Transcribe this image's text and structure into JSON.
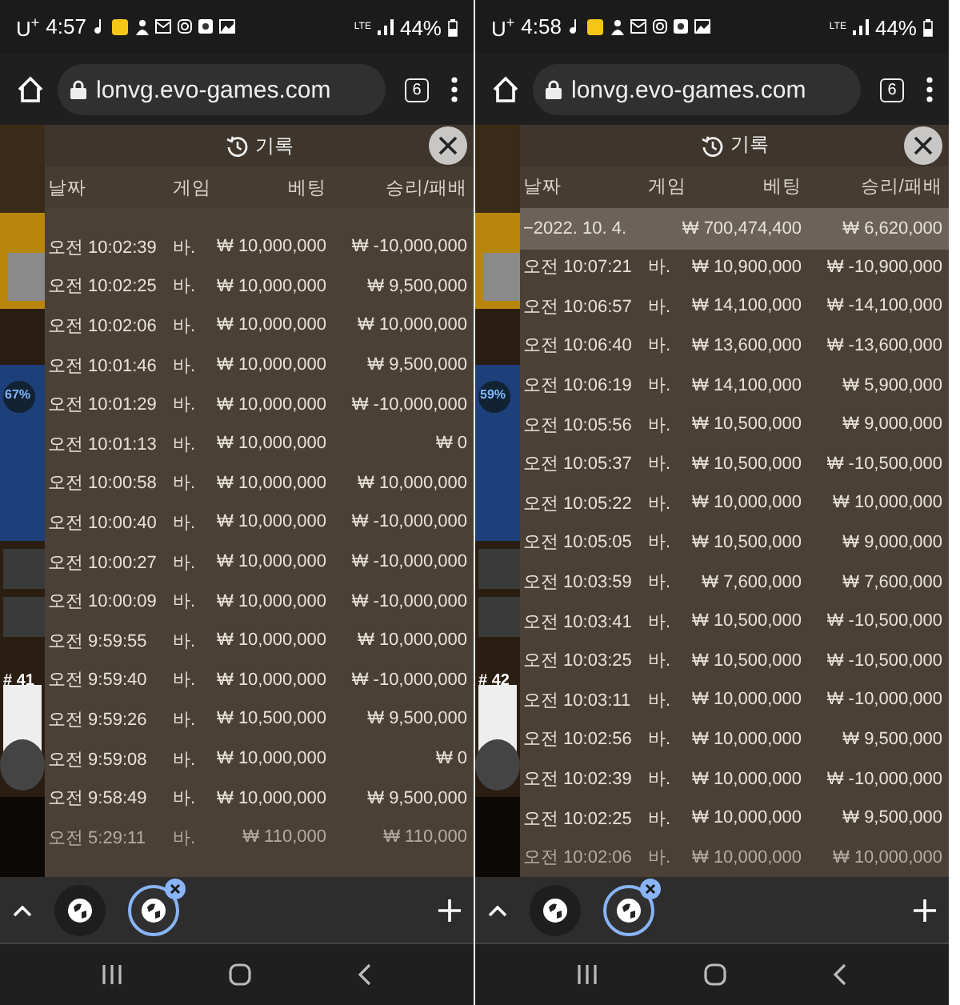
{
  "screens": [
    {
      "status_bar": {
        "carrier": "U$^{+}$",
        "time": "4:57",
        "network": "LTE",
        "battery": "44%"
      },
      "browser": {
        "url": "lonvg.evo-games.com",
        "tab_count": "6"
      },
      "side_labels": [
        {
          "kind": "percent",
          "text": "67%"
        },
        {
          "kind": "round",
          "text": "# 41"
        }
      ],
      "history": {
        "title": "기록",
        "columns": [
          "날짜",
          "게임",
          "베팅",
          "승리/패배"
        ],
        "rows": [
          {
            "kind": "entry",
            "date": "오전 10:02:39",
            "game": "바.",
            "bet": "₩ 10,000,000",
            "result": "₩ -10,000,000",
            "faded": false
          },
          {
            "kind": "entry",
            "date": "오전 10:02:25",
            "game": "바.",
            "bet": "₩ 10,000,000",
            "result": "₩ 9,500,000",
            "faded": false
          },
          {
            "kind": "entry",
            "date": "오전 10:02:06",
            "game": "바.",
            "bet": "₩ 10,000,000",
            "result": "₩ 10,000,000",
            "faded": false
          },
          {
            "kind": "entry",
            "date": "오전 10:01:46",
            "game": "바.",
            "bet": "₩ 10,000,000",
            "result": "₩ 9,500,000",
            "faded": false
          },
          {
            "kind": "entry",
            "date": "오전 10:01:29",
            "game": "바.",
            "bet": "₩ 10,000,000",
            "result": "₩ -10,000,000",
            "faded": false
          },
          {
            "kind": "entry",
            "date": "오전 10:01:13",
            "game": "바.",
            "bet": "₩ 10,000,000",
            "result": "₩ 0",
            "faded": false
          },
          {
            "kind": "entry",
            "date": "오전 10:00:58",
            "game": "바.",
            "bet": "₩ 10,000,000",
            "result": "₩ 10,000,000",
            "faded": false
          },
          {
            "kind": "entry",
            "date": "오전 10:00:40",
            "game": "바.",
            "bet": "₩ 10,000,000",
            "result": "₩ -10,000,000",
            "faded": false
          },
          {
            "kind": "entry",
            "date": "오전 10:00:27",
            "game": "바.",
            "bet": "₩ 10,000,000",
            "result": "₩ -10,000,000",
            "faded": false
          },
          {
            "kind": "entry",
            "date": "오전 10:00:09",
            "game": "바.",
            "bet": "₩ 10,000,000",
            "result": "₩ -10,000,000",
            "faded": false
          },
          {
            "kind": "entry",
            "date": "오전 9:59:55",
            "game": "바.",
            "bet": "₩ 10,000,000",
            "result": "₩ 10,000,000",
            "faded": false
          },
          {
            "kind": "entry",
            "date": "오전 9:59:40",
            "game": "바.",
            "bet": "₩ 10,000,000",
            "result": "₩ -10,000,000",
            "faded": false
          },
          {
            "kind": "entry",
            "date": "오전 9:59:26",
            "game": "바.",
            "bet": "₩ 10,500,000",
            "result": "₩ 9,500,000",
            "faded": false
          },
          {
            "kind": "entry",
            "date": "오전 9:59:08",
            "game": "바.",
            "bet": "₩ 10,000,000",
            "result": "₩ 0",
            "faded": false
          },
          {
            "kind": "entry",
            "date": "오전 9:58:49",
            "game": "바.",
            "bet": "₩ 10,000,000",
            "result": "₩ 9,500,000",
            "faded": false
          },
          {
            "kind": "entry",
            "date": "오전 5:29:11",
            "game": "바.",
            "bet": "₩ 110,000",
            "result": "₩ 110,000",
            "faded": true
          }
        ]
      },
      "tabs": [
        {
          "selected": false
        },
        {
          "selected": true
        }
      ]
    },
    {
      "status_bar": {
        "carrier": "U$^{+}$",
        "time": "4:58",
        "network": "LTE",
        "battery": "44%"
      },
      "browser": {
        "url": "lonvg.evo-games.com",
        "tab_count": "6"
      },
      "side_labels": [
        {
          "kind": "percent",
          "text": "59%"
        },
        {
          "kind": "round",
          "text": "# 42"
        }
      ],
      "history": {
        "title": "기록",
        "columns": [
          "날짜",
          "게임",
          "베팅",
          "승리/패배"
        ],
        "rows": [
          {
            "kind": "summary",
            "date": "−2022. 10. 4.",
            "bet": "₩ 700,474,400",
            "result": "₩ 6,620,000",
            "faded": false
          },
          {
            "kind": "entry",
            "date": "오전 10:07:21",
            "game": "바.",
            "bet": "₩ 10,900,000",
            "result": "₩ -10,900,000",
            "faded": false
          },
          {
            "kind": "entry",
            "date": "오전 10:06:57",
            "game": "바.",
            "bet": "₩ 14,100,000",
            "result": "₩ -14,100,000",
            "faded": false
          },
          {
            "kind": "entry",
            "date": "오전 10:06:40",
            "game": "바.",
            "bet": "₩ 13,600,000",
            "result": "₩ -13,600,000",
            "faded": false
          },
          {
            "kind": "entry",
            "date": "오전 10:06:19",
            "game": "바.",
            "bet": "₩ 14,100,000",
            "result": "₩ 5,900,000",
            "faded": false
          },
          {
            "kind": "entry",
            "date": "오전 10:05:56",
            "game": "바.",
            "bet": "₩ 10,500,000",
            "result": "₩ 9,000,000",
            "faded": false
          },
          {
            "kind": "entry",
            "date": "오전 10:05:37",
            "game": "바.",
            "bet": "₩ 10,500,000",
            "result": "₩ -10,500,000",
            "faded": false
          },
          {
            "kind": "entry",
            "date": "오전 10:05:22",
            "game": "바.",
            "bet": "₩ 10,000,000",
            "result": "₩ 10,000,000",
            "faded": false
          },
          {
            "kind": "entry",
            "date": "오전 10:05:05",
            "game": "바.",
            "bet": "₩ 10,500,000",
            "result": "₩ 9,000,000",
            "faded": false
          },
          {
            "kind": "entry",
            "date": "오전 10:03:59",
            "game": "바.",
            "bet": "₩ 7,600,000",
            "result": "₩ 7,600,000",
            "faded": false
          },
          {
            "kind": "entry",
            "date": "오전 10:03:41",
            "game": "바.",
            "bet": "₩ 10,500,000",
            "result": "₩ -10,500,000",
            "faded": false
          },
          {
            "kind": "entry",
            "date": "오전 10:03:25",
            "game": "바.",
            "bet": "₩ 10,500,000",
            "result": "₩ -10,500,000",
            "faded": false
          },
          {
            "kind": "entry",
            "date": "오전 10:03:11",
            "game": "바.",
            "bet": "₩ 10,000,000",
            "result": "₩ -10,000,000",
            "faded": false
          },
          {
            "kind": "entry",
            "date": "오전 10:02:56",
            "game": "바.",
            "bet": "₩ 10,000,000",
            "result": "₩ 9,500,000",
            "faded": false
          },
          {
            "kind": "entry",
            "date": "오전 10:02:39",
            "game": "바.",
            "bet": "₩ 10,000,000",
            "result": "₩ -10,000,000",
            "faded": false
          },
          {
            "kind": "entry",
            "date": "오전 10:02:25",
            "game": "바.",
            "bet": "₩ 10,000,000",
            "result": "₩ 9,500,000",
            "faded": false
          },
          {
            "kind": "entry",
            "date": "오전 10:02:06",
            "game": "바.",
            "bet": "₩ 10,000,000",
            "result": "₩ 10,000,000",
            "faded": true
          }
        ]
      },
      "tabs": [
        {
          "selected": false
        },
        {
          "selected": true
        }
      ]
    }
  ]
}
